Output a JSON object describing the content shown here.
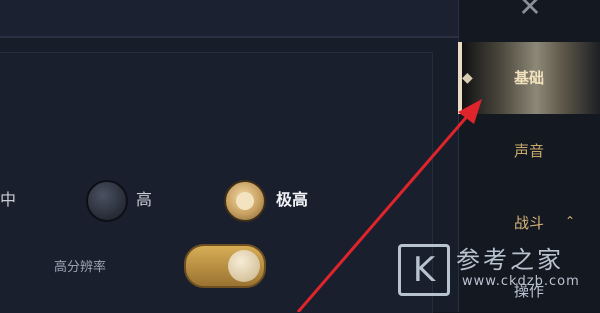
{
  "window": {
    "close_glyph": "✕"
  },
  "sidebar": {
    "items": [
      {
        "label": "基础",
        "active": true
      },
      {
        "label": "声音"
      },
      {
        "label": "战斗",
        "expand_glyph": "⌃"
      },
      {
        "label": "操作"
      }
    ]
  },
  "graphics": {
    "partial_label": "中",
    "option_high": "高",
    "option_ultra": "极高",
    "selected": "极高",
    "hires_label": "高分辨率",
    "hires_on": true
  },
  "watermark": {
    "logo_char": "K",
    "text_cn": "参考之家",
    "url": "www.ckdzb.com"
  },
  "colors": {
    "accent_gold": "#c7a061",
    "arrow_red": "#e0242b"
  }
}
